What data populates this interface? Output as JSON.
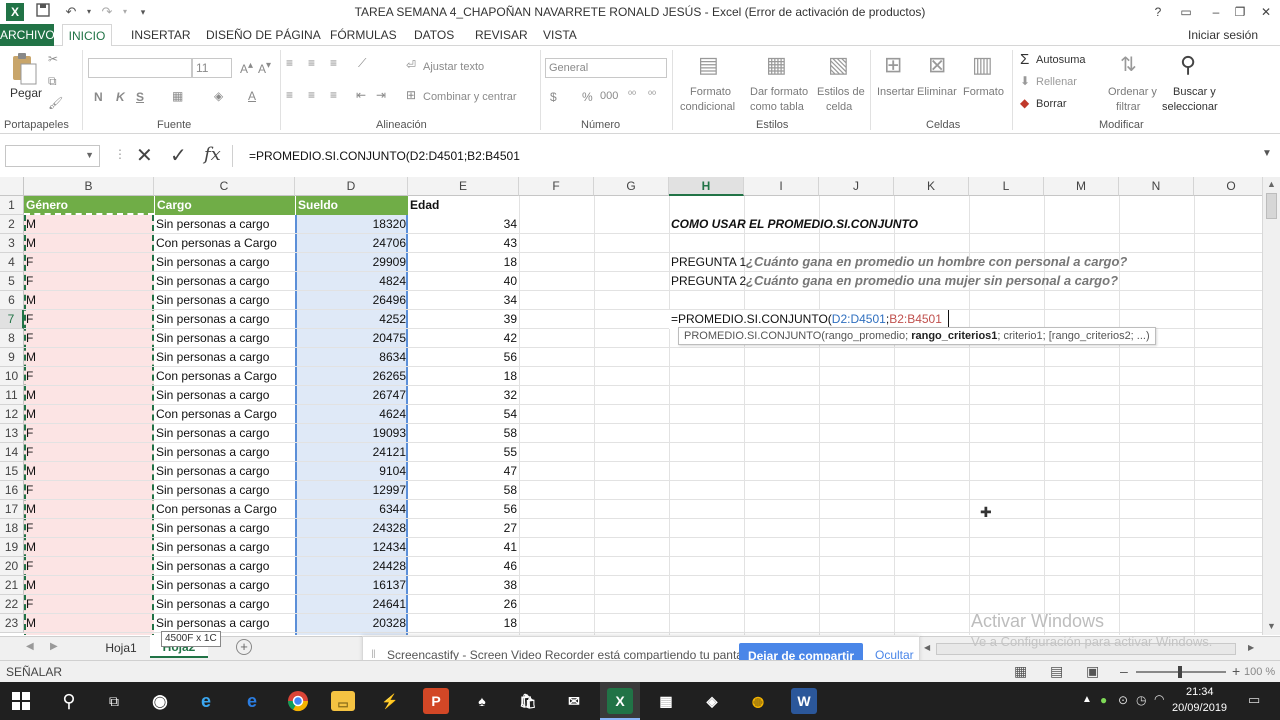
{
  "titlebar": {
    "title": "TAREA SEMANA 4_CHAPOÑAN NAVARRETE RONALD JESÚS - Excel (Error de activación de productos)",
    "help": "?",
    "minimize": "–",
    "restore": "❐",
    "close": "✕"
  },
  "tabs": [
    "ARCHIVO",
    "INICIO",
    "INSERTAR",
    "DISEÑO DE PÁGINA",
    "FÓRMULAS",
    "DATOS",
    "REVISAR",
    "VISTA"
  ],
  "signin": "Iniciar sesión",
  "ribbon": {
    "paste": "Pegar",
    "clipboard": "Portapapeles",
    "font_size": "11",
    "bold": "N",
    "italic": "K",
    "underline": "S",
    "font": "Fuente",
    "wrap_text": "Ajustar texto",
    "merge_center": "Combinar y centrar",
    "alignment": "Alineación",
    "number_format": "General",
    "percent": "%",
    "thousands": "000",
    "number": "Número",
    "cond_format_1": "Formato",
    "cond_format_2": "condicional",
    "format_table_1": "Dar formato",
    "format_table_2": "como tabla",
    "cell_styles_1": "Estilos de",
    "cell_styles_2": "celda",
    "styles": "Estilos",
    "insert": "Insertar",
    "delete": "Eliminar",
    "format": "Formato",
    "cells": "Celdas",
    "autosum": "Autosuma",
    "fill": "Rellenar",
    "clear": "Borrar",
    "sort_1": "Ordenar y",
    "sort_2": "filtrar",
    "find_1": "Buscar y",
    "find_2": "seleccionar",
    "modify": "Modificar"
  },
  "formula_bar": {
    "fx": "fx",
    "formula": "=PROMEDIO.SI.CONJUNTO(D2:D4501;B2:B4501"
  },
  "columns": [
    "B",
    "C",
    "D",
    "E",
    "F",
    "G",
    "H",
    "I",
    "J",
    "K",
    "L",
    "M",
    "N",
    "O"
  ],
  "headers": {
    "genero": "Género",
    "cargo": "Cargo",
    "sueldo": "Sueldo",
    "edad": "Edad"
  },
  "rows": [
    {
      "n": "2",
      "g": "M",
      "c": "Sin personas a cargo",
      "s": "18320",
      "e": "34"
    },
    {
      "n": "3",
      "g": "M",
      "c": "Con personas a Cargo",
      "s": "24706",
      "e": "43"
    },
    {
      "n": "4",
      "g": "F",
      "c": "Sin personas a cargo",
      "s": "29909",
      "e": "18"
    },
    {
      "n": "5",
      "g": "F",
      "c": "Sin personas a cargo",
      "s": "4824",
      "e": "40"
    },
    {
      "n": "6",
      "g": "M",
      "c": "Sin personas a cargo",
      "s": "26496",
      "e": "34"
    },
    {
      "n": "7",
      "g": "F",
      "c": "Sin personas a cargo",
      "s": "4252",
      "e": "39"
    },
    {
      "n": "8",
      "g": "F",
      "c": "Sin personas a cargo",
      "s": "20475",
      "e": "42"
    },
    {
      "n": "9",
      "g": "M",
      "c": "Sin personas a cargo",
      "s": "8634",
      "e": "56"
    },
    {
      "n": "10",
      "g": "F",
      "c": "Con personas a Cargo",
      "s": "26265",
      "e": "18"
    },
    {
      "n": "11",
      "g": "M",
      "c": "Sin personas a cargo",
      "s": "26747",
      "e": "32"
    },
    {
      "n": "12",
      "g": "M",
      "c": "Con personas a Cargo",
      "s": "4624",
      "e": "54"
    },
    {
      "n": "13",
      "g": "F",
      "c": "Sin personas a cargo",
      "s": "19093",
      "e": "58"
    },
    {
      "n": "14",
      "g": "F",
      "c": "Sin personas a cargo",
      "s": "24121",
      "e": "55"
    },
    {
      "n": "15",
      "g": "M",
      "c": "Sin personas a cargo",
      "s": "9104",
      "e": "47"
    },
    {
      "n": "16",
      "g": "F",
      "c": "Sin personas a cargo",
      "s": "12997",
      "e": "58"
    },
    {
      "n": "17",
      "g": "M",
      "c": "Con personas a Cargo",
      "s": "6344",
      "e": "56"
    },
    {
      "n": "18",
      "g": "F",
      "c": "Sin personas a cargo",
      "s": "24328",
      "e": "27"
    },
    {
      "n": "19",
      "g": "M",
      "c": "Sin personas a cargo",
      "s": "12434",
      "e": "41"
    },
    {
      "n": "20",
      "g": "F",
      "c": "Sin personas a cargo",
      "s": "24428",
      "e": "46"
    },
    {
      "n": "21",
      "g": "M",
      "c": "Sin personas a cargo",
      "s": "16137",
      "e": "38"
    },
    {
      "n": "22",
      "g": "F",
      "c": "Sin personas a cargo",
      "s": "24641",
      "e": "26"
    },
    {
      "n": "23",
      "g": "M",
      "c": "Sin personas a cargo",
      "s": "20328",
      "e": "18"
    }
  ],
  "notes": {
    "title": "COMO USAR EL PROMEDIO.SI.CONJUNTO",
    "q1_label": "PREGUNTA 1",
    "q1_text": "¿Cuánto gana en promedio un hombre con personal a cargo?",
    "q2_label": "PREGUNTA 2",
    "q2_text": "¿Cuánto gana en promedio una mujer sin personal a cargo?",
    "edit_prefix": "=PROMEDIO.SI.CONJUNTO(",
    "edit_arg1": "D2:D4501",
    "edit_sep": ";",
    "edit_arg2": "B2:B4501",
    "tooltip_a": "PROMEDIO.SI.CONJUNTO(rango_promedio; ",
    "tooltip_b": "rango_criterios1",
    "tooltip_c": "; criterio1; [rango_criterios2; ...)"
  },
  "sheets": [
    "Hoja1",
    "Hoja2"
  ],
  "selection_tip": "4500F x 1C",
  "screencastify": {
    "message": "Screencastify - Screen Video Recorder está compartiendo tu pantalla.",
    "stop": "Dejar de compartir",
    "hide": "Ocultar"
  },
  "watermark": {
    "line1": "Activar Windows",
    "line2": "Ve a Configuración para activar Windows."
  },
  "status": {
    "mode": "SEÑALAR",
    "zoom": "100 %"
  },
  "taskbar": {
    "time": "21:34",
    "date": "20/09/2019"
  },
  "colors": {
    "excel_green": "#217346",
    "header_green": "#70ad47",
    "pink": "#fce4e4",
    "blue_fill": "#dfe9f7",
    "arg1": "#2f6fbf",
    "arg2": "#c0504d"
  }
}
